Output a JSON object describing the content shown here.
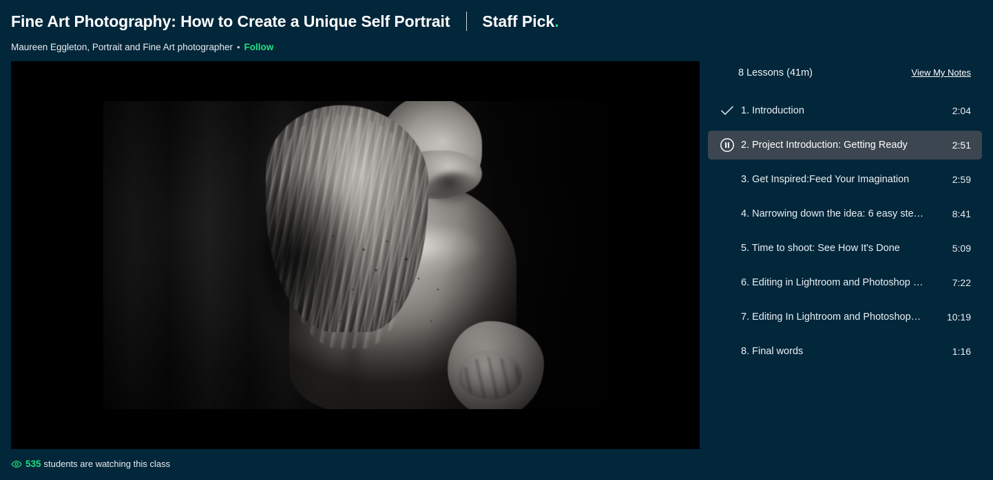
{
  "header": {
    "class_title": "Fine Art Photography: How to Create a Unique Self Portrait",
    "badge_text": "Staff Pick",
    "badge_period": ".",
    "author": "Maureen Eggleton, Portrait and Fine Art photographer",
    "separator": "•",
    "follow_label": "Follow"
  },
  "player": {
    "watching_count": "535",
    "watching_text": "students are watching this class",
    "eye_icon": "eye-icon"
  },
  "lessons_panel": {
    "summary": "8 Lessons (41m)",
    "notes_link": "View My Notes",
    "items": [
      {
        "title": "1. Introduction",
        "duration": "2:04",
        "state": "completed",
        "icon": "check-icon"
      },
      {
        "title": "2. Project Introduction: Getting Ready",
        "duration": "2:51",
        "state": "playing",
        "icon": "pause-circle-icon"
      },
      {
        "title": "3. Get Inspired:Feed Your Imagination",
        "duration": "2:59",
        "state": "default",
        "icon": ""
      },
      {
        "title": "4. Narrowing down the idea: 6 easy ste…",
        "duration": "8:41",
        "state": "default",
        "icon": ""
      },
      {
        "title": "5. Time to shoot: See How It's Done",
        "duration": "5:09",
        "state": "default",
        "icon": ""
      },
      {
        "title": "6. Editing in Lightroom and Photoshop …",
        "duration": "7:22",
        "state": "default",
        "icon": ""
      },
      {
        "title": "7. Editing In Lightroom and Photoshop…",
        "duration": "10:19",
        "state": "default",
        "icon": ""
      },
      {
        "title": "8. Final words",
        "duration": "1:16",
        "state": "default",
        "icon": ""
      }
    ]
  },
  "colors": {
    "page_background": "#02263a",
    "accent_green": "#21e27f",
    "active_row": "#3c4650",
    "text_primary": "#ffffff",
    "text_secondary": "#e9eff3"
  }
}
